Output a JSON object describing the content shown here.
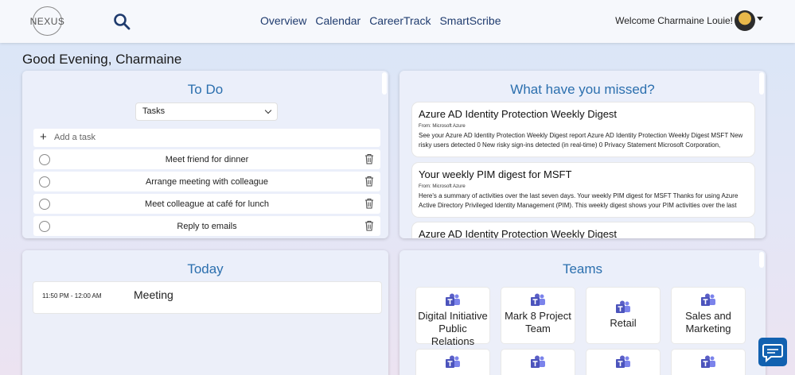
{
  "header": {
    "logo_text": "NEXUS",
    "nav": [
      "Overview",
      "Calendar",
      "CareerTrack",
      "SmartScribe"
    ],
    "welcome": "Welcome Charmaine Louie!"
  },
  "greeting": "Good Evening, Charmaine",
  "todo": {
    "title": "To Do",
    "list_select": "Tasks",
    "add_placeholder": "Add a task",
    "tasks": [
      "Meet friend for dinner",
      "Arrange meeting with colleague",
      "Meet colleague at café for lunch",
      "Reply to emails"
    ]
  },
  "missed": {
    "title": "What have you missed?",
    "emails": [
      {
        "subject": "Azure AD Identity Protection Weekly Digest",
        "from": "From: Microsoft Azure",
        "body": "See your Azure AD Identity Protection Weekly Digest report Azure AD Identity Protection Weekly Digest MSFT New risky users detected 0 New risky sign-ins detected (in real-time) 0 Privacy Statement Microsoft Corporation,"
      },
      {
        "subject": "Your weekly PIM digest for MSFT",
        "from": "From: Microsoft Azure",
        "body": "Here's a summary of activities over the last seven days. Your weekly PIM digest for MSFT Thanks for using Azure Active Directory Privileged Identity Management (PIM). This weekly digest shows your PIM activities over the last"
      },
      {
        "subject": "Azure AD Identity Protection Weekly Digest",
        "from": "",
        "body": ""
      }
    ]
  },
  "today": {
    "title": "Today",
    "event_time": "11:50 PM - 12:00 AM",
    "event_title": "Meeting"
  },
  "teams": {
    "title": "Teams",
    "tiles": [
      "Digital Initiative Public Relations",
      "Mark 8 Project Team",
      "Retail",
      "Sales and Marketing"
    ]
  },
  "colors": {
    "accent": "#2b6fae",
    "nav": "#1f3b6e",
    "teams_purple": "#5b5fc7",
    "chat": "#1261b0"
  },
  "icons": [
    "search-icon",
    "trash-icon",
    "plus-icon",
    "teams-icon",
    "chat-icon",
    "chevron-down-icon"
  ]
}
